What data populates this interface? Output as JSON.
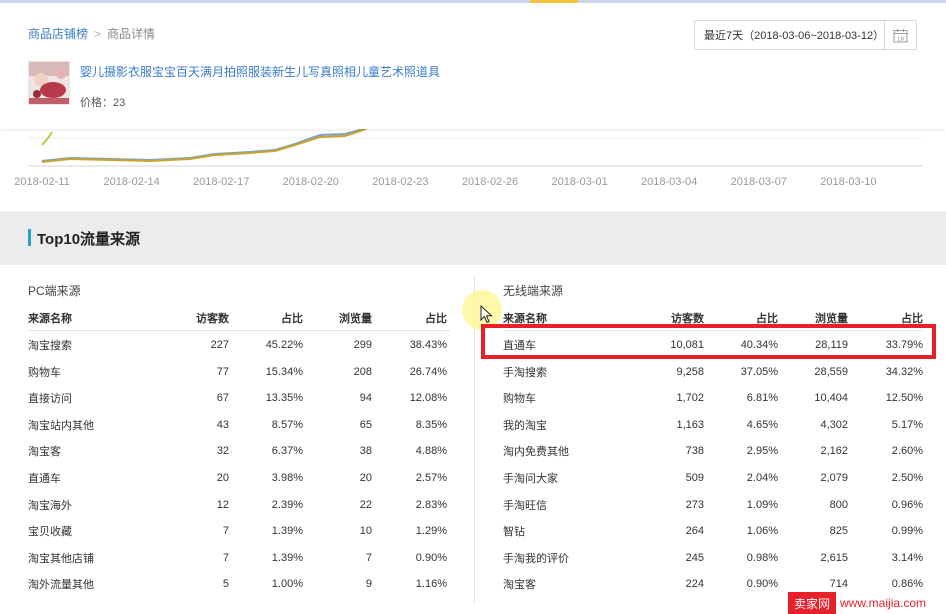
{
  "breadcrumb": {
    "root": "商品店铺榜",
    "separator": ">",
    "current": "商品详情"
  },
  "date_range": {
    "label": "最近7天（2018-03-06~2018-03-12）",
    "calendar_day": "18"
  },
  "product": {
    "title": "婴儿摄影衣服宝宝百天满月拍照服装新生儿写真照相儿童艺术照道具",
    "price": "价格：23"
  },
  "trend_chart": {
    "x_ticks": [
      "2018-02-11",
      "2018-02-14",
      "2018-02-17",
      "2018-02-20",
      "2018-02-23",
      "2018-02-26",
      "2018-03-01",
      "2018-03-04",
      "2018-03-07",
      "2018-03-10"
    ],
    "colors": {
      "line_main": "#c9a62a",
      "line_secondary": "#7b9fcc",
      "line_early": "#b7cc3c"
    }
  },
  "section": {
    "title": "Top10流量来源"
  },
  "pc_table": {
    "label": "PC端来源",
    "headers": [
      "来源名称",
      "访客数",
      "占比",
      "浏览量",
      "占比"
    ],
    "rows": [
      [
        "淘宝搜索",
        "227",
        "45.22%",
        "299",
        "38.43%"
      ],
      [
        "购物车",
        "77",
        "15.34%",
        "208",
        "26.74%"
      ],
      [
        "直接访问",
        "67",
        "13.35%",
        "94",
        "12.08%"
      ],
      [
        "淘宝站内其他",
        "43",
        "8.57%",
        "65",
        "8.35%"
      ],
      [
        "淘宝客",
        "32",
        "6.37%",
        "38",
        "4.88%"
      ],
      [
        "直通车",
        "20",
        "3.98%",
        "20",
        "2.57%"
      ],
      [
        "淘宝海外",
        "12",
        "2.39%",
        "22",
        "2.83%"
      ],
      [
        "宝贝收藏",
        "7",
        "1.39%",
        "10",
        "1.29%"
      ],
      [
        "淘宝其他店铺",
        "7",
        "1.39%",
        "7",
        "0.90%"
      ],
      [
        "淘外流量其他",
        "5",
        "1.00%",
        "9",
        "1.16%"
      ]
    ]
  },
  "mobile_table": {
    "label": "无线端来源",
    "headers": [
      "来源名称",
      "访客数",
      "占比",
      "浏览量",
      "占比"
    ],
    "rows": [
      [
        "直通车",
        "10,081",
        "40.34%",
        "28,119",
        "33.79%"
      ],
      [
        "手淘搜索",
        "9,258",
        "37.05%",
        "28,559",
        "34.32%"
      ],
      [
        "购物车",
        "1,702",
        "6.81%",
        "10,404",
        "12.50%"
      ],
      [
        "我的淘宝",
        "1,163",
        "4.65%",
        "4,302",
        "5.17%"
      ],
      [
        "淘内免费其他",
        "738",
        "2.95%",
        "2,162",
        "2.60%"
      ],
      [
        "手淘问大家",
        "509",
        "2.04%",
        "2,079",
        "2.50%"
      ],
      [
        "手淘旺信",
        "273",
        "1.09%",
        "800",
        "0.96%"
      ],
      [
        "智钻",
        "264",
        "1.06%",
        "825",
        "0.99%"
      ],
      [
        "手淘我的评价",
        "245",
        "0.98%",
        "2,615",
        "3.14%"
      ],
      [
        "淘宝客",
        "224",
        "0.90%",
        "714",
        "0.86%"
      ]
    ]
  },
  "watermark": {
    "badge": "卖家网",
    "url": "www.maijia.com"
  },
  "colors": {
    "link": "#3a7bc8",
    "accent": "#2a9fd6",
    "highlight": "#e8202a"
  }
}
